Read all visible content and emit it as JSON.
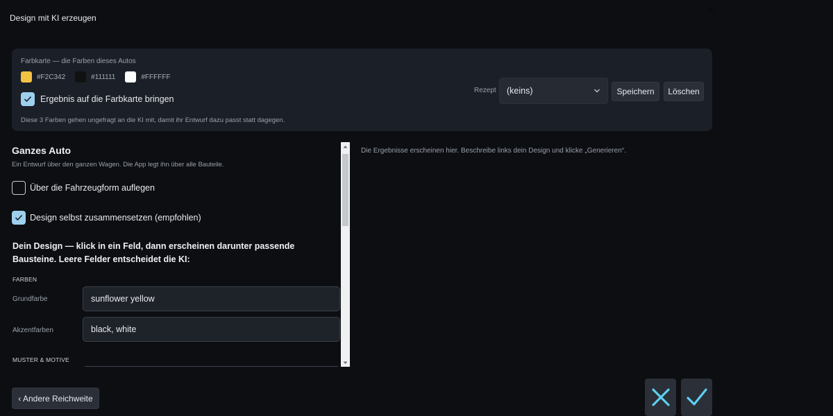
{
  "window": {
    "title": "Design mit KI erzeugen"
  },
  "color_card": {
    "title": "Farbkarte — die Farben dieses Autos",
    "swatches": [
      {
        "hex": "#F2C342",
        "label": "#F2C342"
      },
      {
        "hex": "#111111",
        "label": "#111111"
      },
      {
        "hex": "#FFFFFF",
        "label": "#FFFFFF"
      }
    ],
    "apply_checkbox": {
      "label": "Ergebnis auf die Farbkarte bringen",
      "checked": true
    },
    "note": "Diese 3 Farben gehen ungefragt an die KI mit, damit ihr Entwurf dazu passt statt dagegen.",
    "recipe_label": "Rezept",
    "recipe_value": "(keins)",
    "save_label": "Speichern",
    "delete_label": "Löschen"
  },
  "section": {
    "title": "Ganzes Auto",
    "subtitle": "Ein Entwurf über den ganzen Wagen. Die App legt ihn über alle Bauteile.",
    "option_overlay": {
      "label": "Über die Fahrzeugform auflegen",
      "checked": false
    },
    "option_compose": {
      "label": "Design selbst zusammensetzen (empfohlen)",
      "checked": true
    },
    "design_heading": "Dein Design — klick in ein Feld, dann erscheinen darunter passende Bausteine. Leere Felder entscheidet die KI:",
    "group_colors": "FARBEN",
    "base_color_label": "Grundfarbe",
    "base_color_value": "sunflower yellow",
    "accent_label": "Akzentfarben",
    "accent_value": "black, white",
    "group_patterns": "MUSTER & MOTIVE"
  },
  "results_note": "Die Ergebnisse erscheinen hier. Beschreibe links dein Design und klicke „Generieren“.",
  "footer": {
    "back_label": "‹ Andere Reichweite"
  },
  "colors": {
    "accent": "#9ed0ee",
    "icon_cyan": "#5fd0f0"
  }
}
